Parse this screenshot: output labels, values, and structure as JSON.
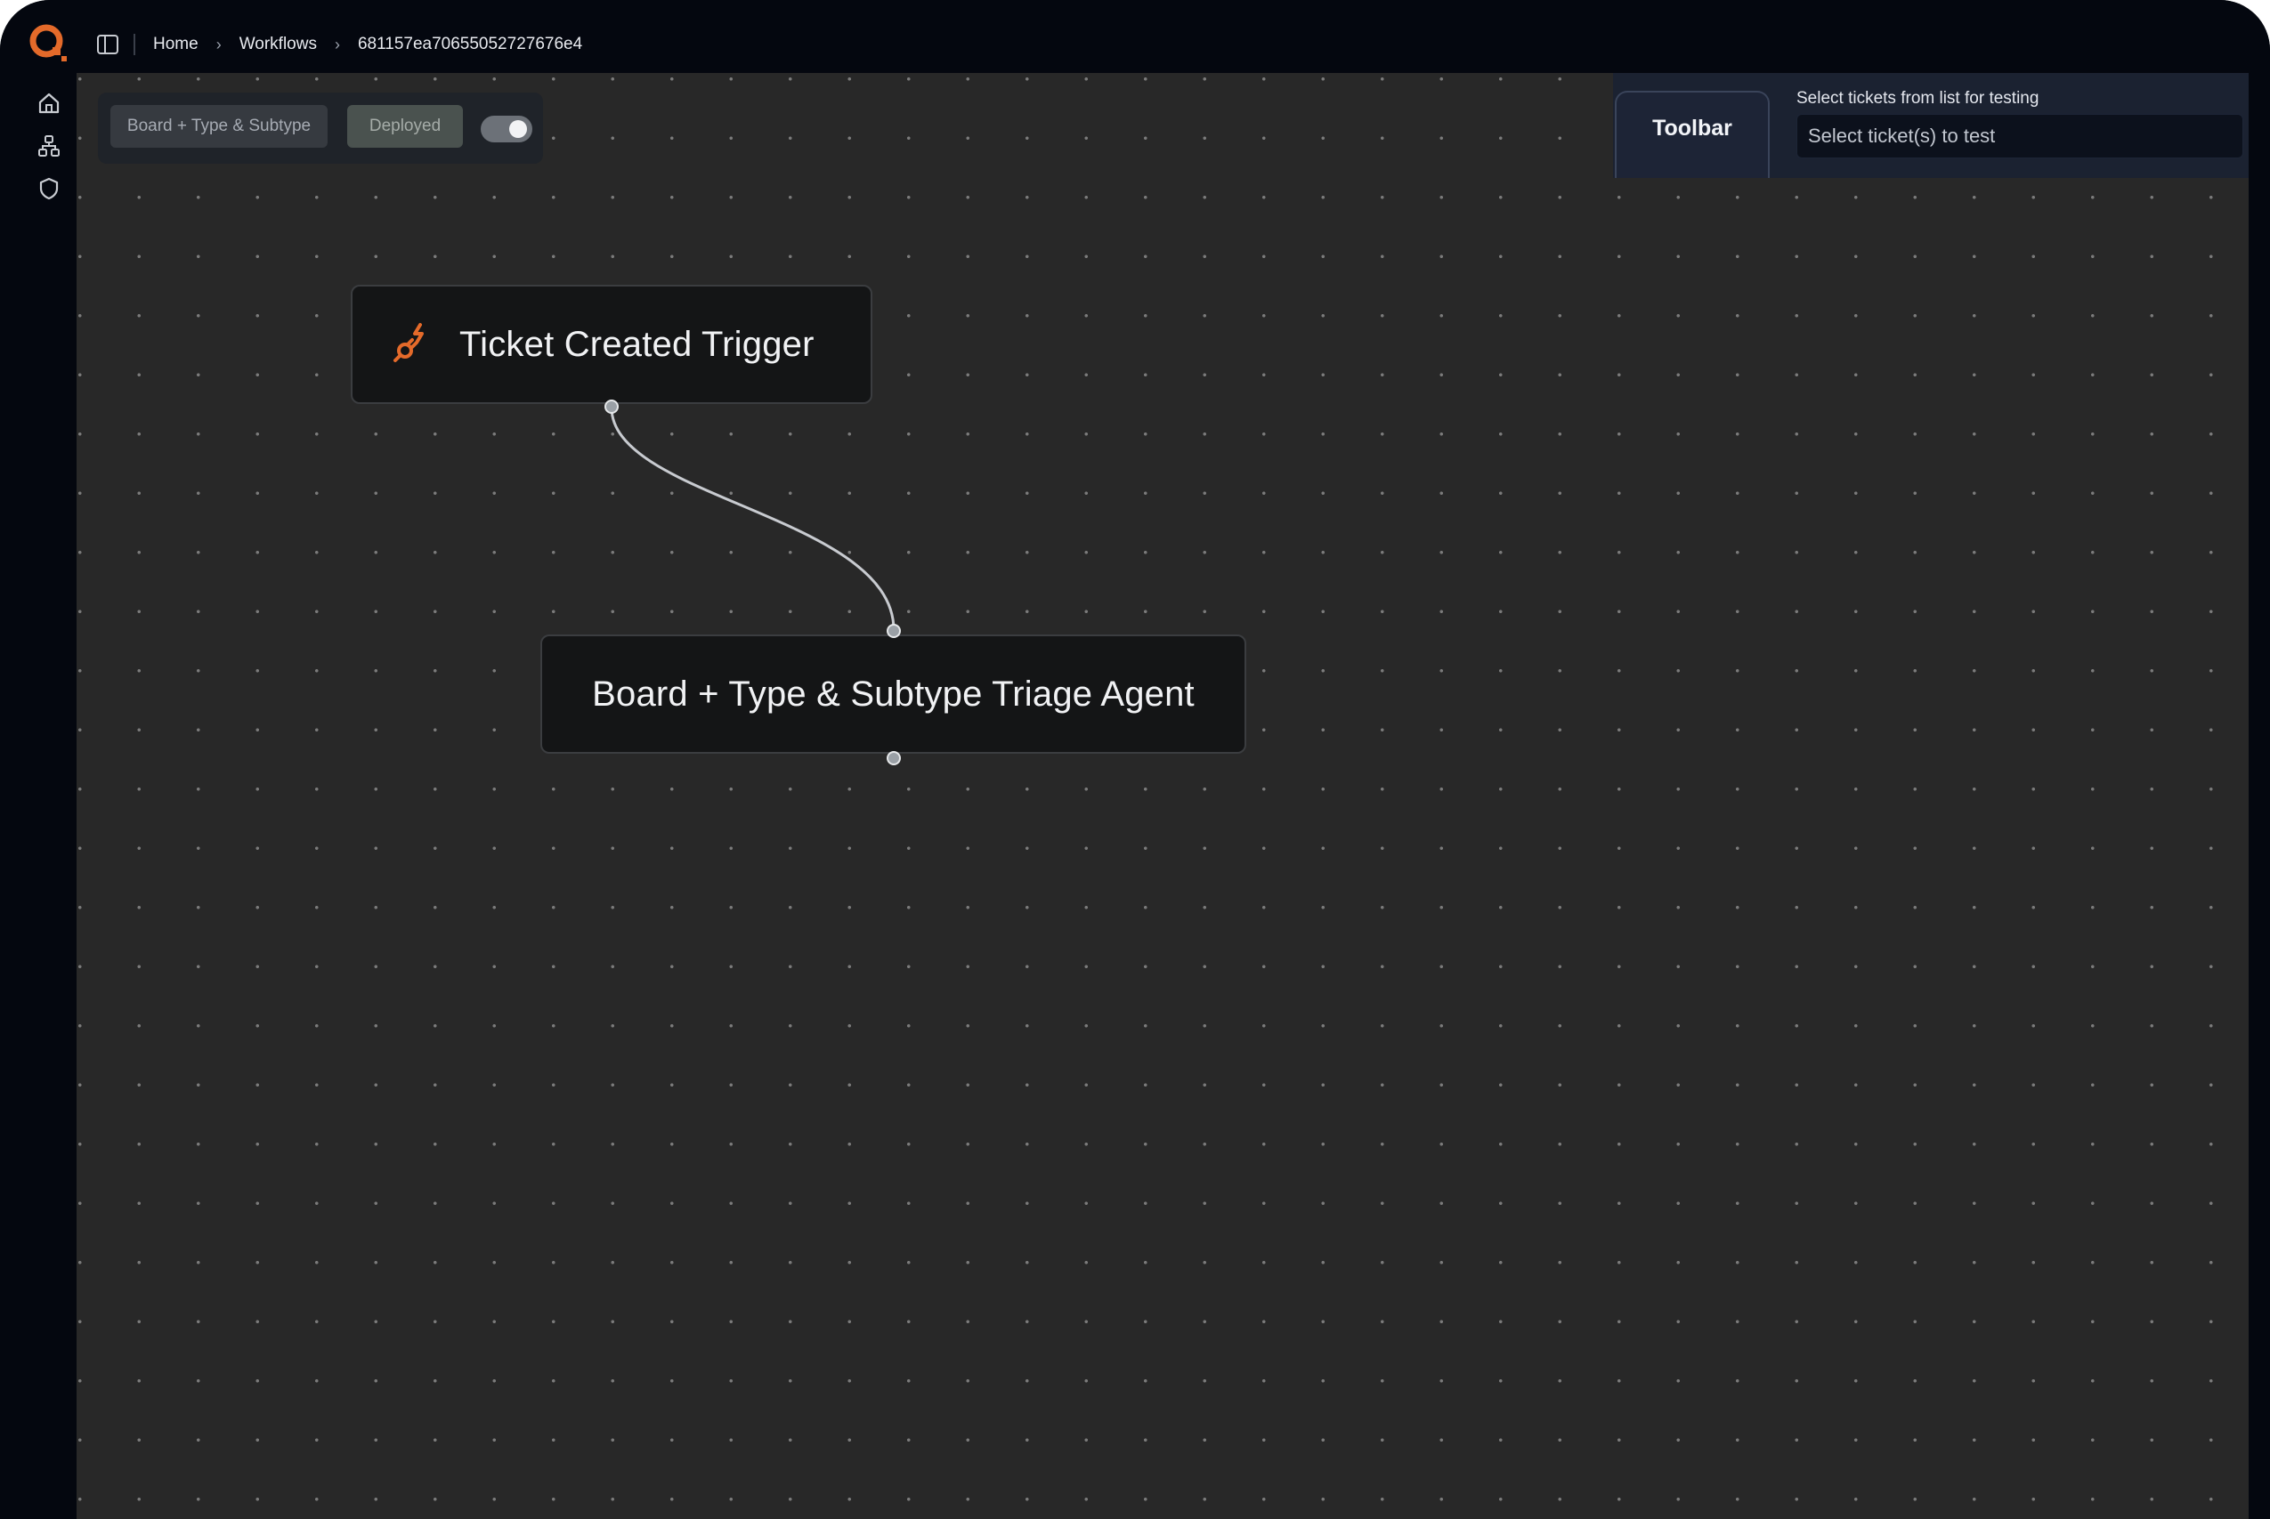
{
  "breadcrumb": {
    "home": "Home",
    "workflows": "Workflows",
    "current": "681157ea70655052727676e4"
  },
  "controls": {
    "workflow_name": "Board + Type & Subtype",
    "status": "Deployed",
    "toggle_on": true
  },
  "toolbar": {
    "tab_label": "Toolbar",
    "ticket_label": "Select tickets from list for testing",
    "ticket_placeholder": "Select ticket(s) to test"
  },
  "nodes": {
    "trigger": {
      "title": "Ticket Created Trigger",
      "icon": "plug-lightning-icon"
    },
    "agent": {
      "title": "Board + Type & Subtype Triage Agent"
    }
  },
  "rail": {
    "items": [
      {
        "icon": "home-icon"
      },
      {
        "icon": "workflow-tree-icon"
      },
      {
        "icon": "shield-icon"
      }
    ]
  },
  "colors": {
    "brand": "#e46a2a",
    "canvas": "#282828",
    "chrome": "#04070f",
    "node": "#141516",
    "toolbar": "#1b2231"
  }
}
